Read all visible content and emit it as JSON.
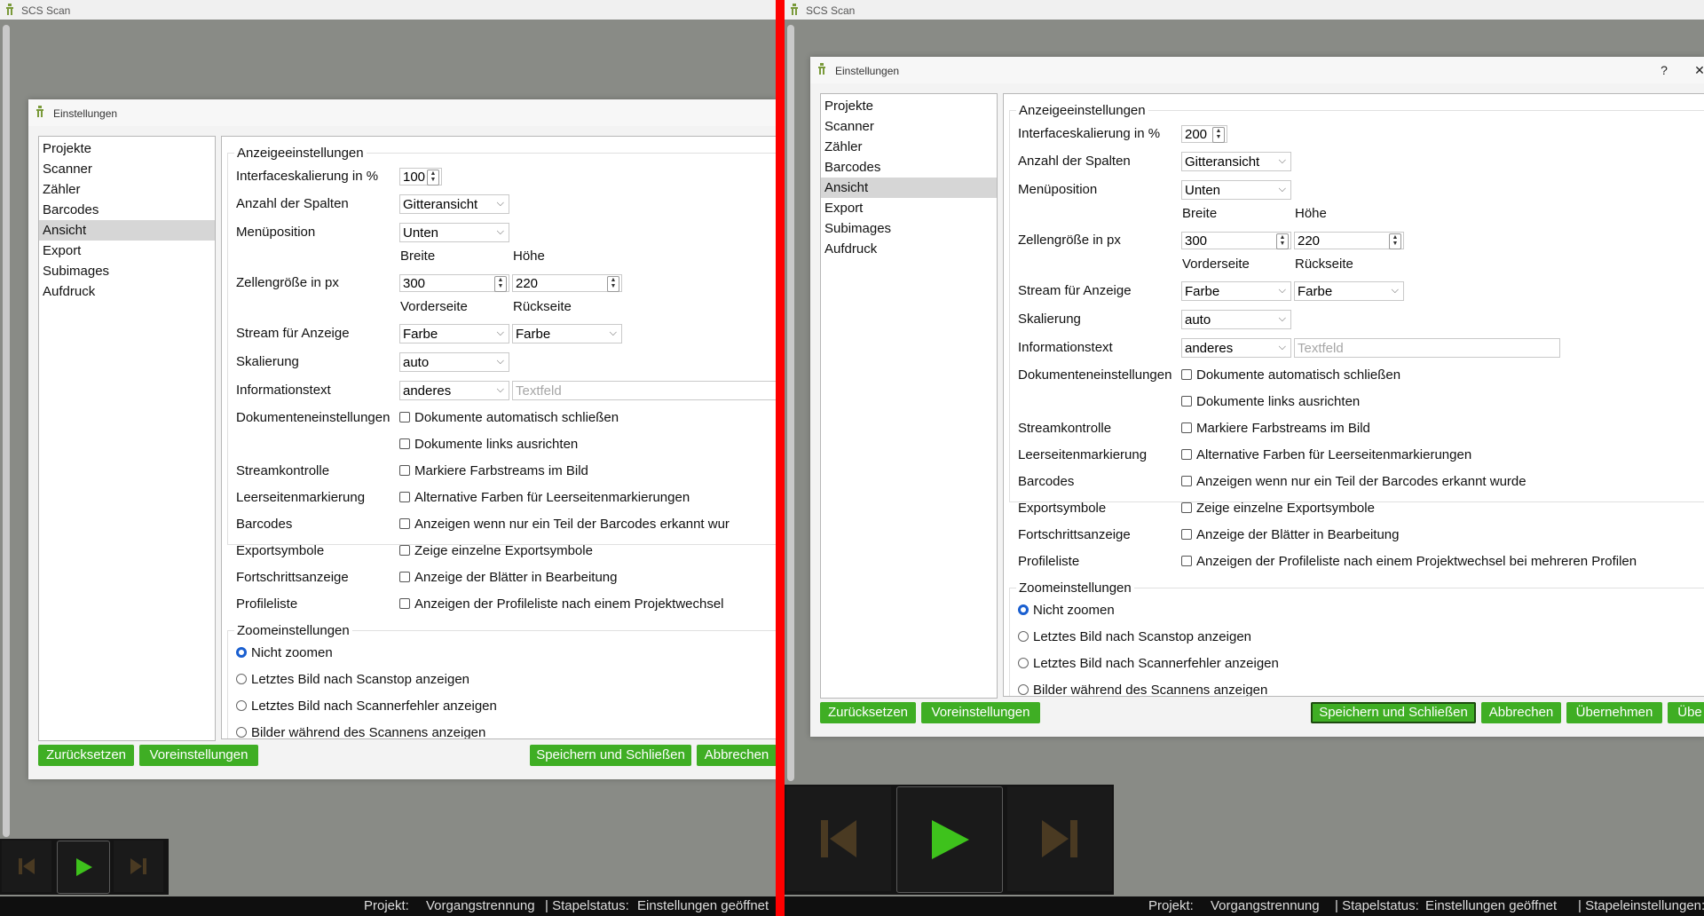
{
  "app": {
    "title": "SCS Scan"
  },
  "dialog": {
    "title": "Einstellungen",
    "help": "?",
    "close": "✕"
  },
  "nav": [
    "Projekte",
    "Scanner",
    "Zähler",
    "Barcodes",
    "Ansicht",
    "Export",
    "Subimages",
    "Aufdruck"
  ],
  "display": {
    "group": "Anzeigeeinstellungen",
    "scale_label": "Interfaceskalierung in %",
    "scale_left": "100",
    "scale_right": "200",
    "columns_label": "Anzahl der Spalten",
    "columns_value": "Gitteransicht",
    "menu_label": "Menüposition",
    "menu_value": "Unten",
    "width_header": "Breite",
    "height_header": "Höhe",
    "cell_label": "Zellengröße in px",
    "cell_width": "300",
    "cell_height": "220",
    "front_header": "Vorderseite",
    "back_header": "Rückseite",
    "stream_label": "Stream für Anzeige",
    "stream_front": "Farbe",
    "stream_back": "Farbe",
    "scaling_label": "Skalierung",
    "scaling_value": "auto",
    "info_label": "Informationstext",
    "info_value": "anderes",
    "info_placeholder": "Textfeld",
    "doc_label": "Dokumenteneinstellungen",
    "doc_close": "Dokumente automatisch schließen",
    "doc_left": "Dokumente links ausrichten",
    "stream_ctrl_label": "Streamkontrolle",
    "stream_ctrl": "Markiere Farbstreams im Bild",
    "blank_label": "Leerseitenmarkierung",
    "blank": "Alternative Farben für Leerseitenmarkierungen",
    "barcodes_label": "Barcodes",
    "barcodes_left": "Anzeigen wenn nur ein Teil der Barcodes erkannt wur",
    "barcodes_right": "Anzeigen wenn nur ein Teil der Barcodes erkannt wurde",
    "export_label": "Exportsymbole",
    "export": "Zeige einzelne Exportsymbole",
    "progress_label": "Fortschrittsanzeige",
    "progress": "Anzeige der Blätter in Bearbeitung",
    "profile_label": "Profileliste",
    "profile_left": "Anzeigen der Profileliste nach einem Projektwechsel",
    "profile_right": "Anzeigen der Profileliste nach einem Projektwechsel bei mehreren Profilen"
  },
  "zoom": {
    "group": "Zoomeinstellungen",
    "opt1": "Nicht zoomen",
    "opt2": "Letztes Bild nach Scanstop anzeigen",
    "opt3": "Letztes Bild nach Scannerfehler anzeigen",
    "opt4": "Bilder während des Scannens anzeigen"
  },
  "buttons": {
    "reset": "Zurücksetzen",
    "defaults": "Voreinstellungen",
    "save_close": "Speichern und Schließen",
    "save_close_right": "Speichern und Schließen",
    "cancel": "Abbrechen",
    "apply": "Übernehmen",
    "apply_partial": "Übe"
  },
  "status": {
    "project_label": "Projekt:",
    "project_value": "Vorgangstrennung",
    "stack_label": "| Stapelstatus:",
    "stack_value": "Einstellungen geöffnet",
    "stack_settings_partial": "| Stapeleinstellungen:"
  },
  "colors": {
    "accent_green": "#3fae24",
    "divider_red": "#ff0000",
    "play_green": "#3ec21c",
    "skip_brown": "#4a3a22"
  }
}
